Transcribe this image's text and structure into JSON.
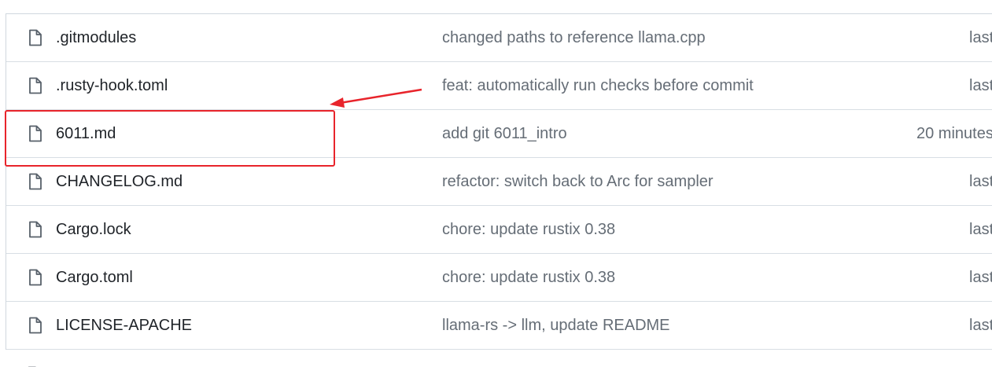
{
  "files": [
    {
      "name": ".gitmodules",
      "message": "changed paths to reference llama.cpp",
      "time": "last"
    },
    {
      "name": ".rusty-hook.toml",
      "message": "feat: automatically run checks before commit",
      "time": "last"
    },
    {
      "name": "6011.md",
      "message": "add git 6011_intro",
      "time": "20 minutes"
    },
    {
      "name": "CHANGELOG.md",
      "message": "refactor: switch back to Arc for sampler",
      "time": "last"
    },
    {
      "name": "Cargo.lock",
      "message": "chore: update rustix 0.38",
      "time": "last"
    },
    {
      "name": "Cargo.toml",
      "message": "chore: update rustix 0.38",
      "time": "last"
    },
    {
      "name": "LICENSE-APACHE",
      "message": "llama-rs -> llm, update README",
      "time": "last"
    }
  ],
  "icons": {
    "file": "file-icon"
  },
  "annotation": {
    "color": "#e8242b",
    "target": "6011.md"
  }
}
